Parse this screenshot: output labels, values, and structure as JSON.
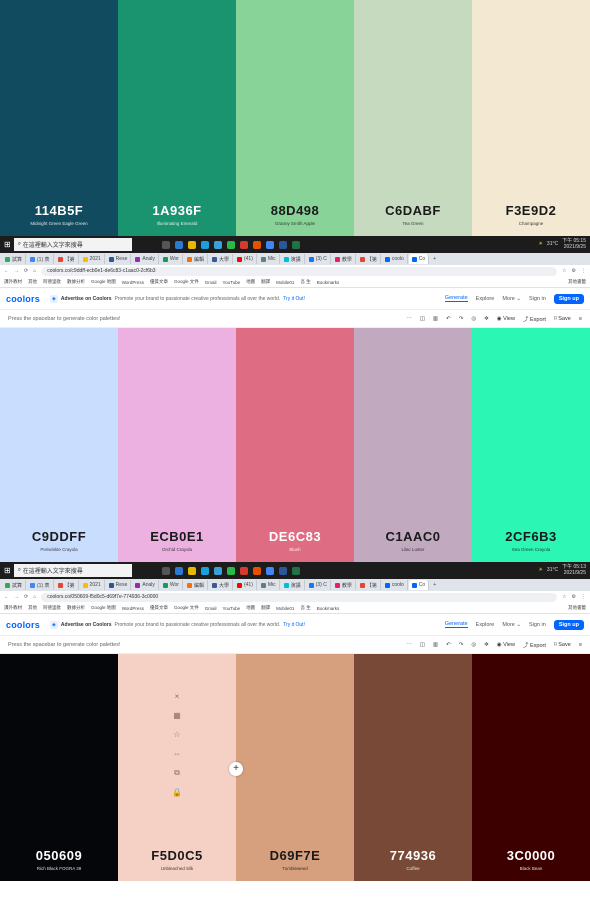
{
  "palette1": [
    {
      "hex": "114B5F",
      "name": "Midnight Green Eagle Green",
      "bg": "#114B5F",
      "fg": "#ffffff"
    },
    {
      "hex": "1A936F",
      "name": "Illuminating Emerald",
      "bg": "#1A936F",
      "fg": "#ffffff"
    },
    {
      "hex": "88D498",
      "name": "Granny Smith Apple",
      "bg": "#88D498",
      "fg": "#1a1a1a"
    },
    {
      "hex": "C6DABF",
      "name": "Tea Green",
      "bg": "#C6DABF",
      "fg": "#1a1a1a"
    },
    {
      "hex": "F3E9D2",
      "name": "Champagne",
      "bg": "#F3E9D2",
      "fg": "#1a1a1a"
    }
  ],
  "palette2": [
    {
      "hex": "C9DDFF",
      "name": "Periwinkle Crayola",
      "bg": "#C9DDFF",
      "fg": "#1a1a1a"
    },
    {
      "hex": "ECB0E1",
      "name": "Orchid Crayola",
      "bg": "#ECB0E1",
      "fg": "#1a1a1a"
    },
    {
      "hex": "DE6C83",
      "name": "Blush",
      "bg": "#DE6C83",
      "fg": "#ffffff"
    },
    {
      "hex": "C1AAC0",
      "name": "Lilac Luster",
      "bg": "#C1AAC0",
      "fg": "#1a1a1a"
    },
    {
      "hex": "2CF6B3",
      "name": "Sea Green Crayola",
      "bg": "#2CF6B3",
      "fg": "#1a1a1a"
    }
  ],
  "palette3": [
    {
      "hex": "050609",
      "name": "Rich Black FOGRA 39",
      "bg": "#050609",
      "fg": "#ffffff"
    },
    {
      "hex": "F5D0C5",
      "name": "Unbleached Silk",
      "bg": "#F5D0C5",
      "fg": "#1a1a1a"
    },
    {
      "hex": "D69F7E",
      "name": "Tumbleweed",
      "bg": "#D69F7E",
      "fg": "#1a1a1a"
    },
    {
      "hex": "774936",
      "name": "Coffee",
      "bg": "#774936",
      "fg": "#ffffff"
    },
    {
      "hex": "3C0000",
      "name": "Black Bean",
      "bg": "#3C0000",
      "fg": "#ffffff"
    }
  ],
  "taskbar": {
    "search": "在這裡輸入文字來搜尋",
    "temp": "31°C",
    "time": "下午 05:15",
    "date": "2021/9/25",
    "time2": "下午 05:13"
  },
  "browser1": {
    "url": "coolors.co/c9ddff-ecb0e1-de6c83-c1aac0-2cf6b3"
  },
  "browser2": {
    "url": "coolors.co/050609-f5d0c5-d69f7e-774936-3c0000"
  },
  "tabs": [
    "試算",
    "(1) 表",
    "【第",
    "2021",
    "Rese",
    "Analy",
    "Wor",
    "編輯",
    "大學",
    "(41)",
    "Mic",
    "演講",
    "(3) C",
    "教學",
    "【第",
    "coolo",
    "Co"
  ],
  "bookmarks": [
    "課外教材",
    "其他",
    "阿德里歐",
    "數據分析",
    "Google 地圖",
    "WordPress",
    "優質文章",
    "Google 文件",
    "Gmail",
    "YouTube",
    "地圖",
    "翻譯",
    "Mobile01",
    "吾 生",
    "Bookmarks",
    "其他書籤"
  ],
  "nav": {
    "logo": "coolors",
    "advertise": "Advertise on Coolors",
    "promo": "Promote your brand to passionate creative professionals all over the world.",
    "try": "Try it Out!",
    "generate": "Generate",
    "explore": "Explore",
    "more": "More",
    "signin": "Sign in",
    "signup": "Sign up"
  },
  "toolbar": {
    "hint": "Press the spacebar to generate color palettes!",
    "view": "View",
    "export": "Export",
    "save": "Save"
  },
  "overlay_icons": [
    "×",
    "▦",
    "☆",
    "⇔",
    "⧉",
    "🔒"
  ],
  "plus": "+"
}
